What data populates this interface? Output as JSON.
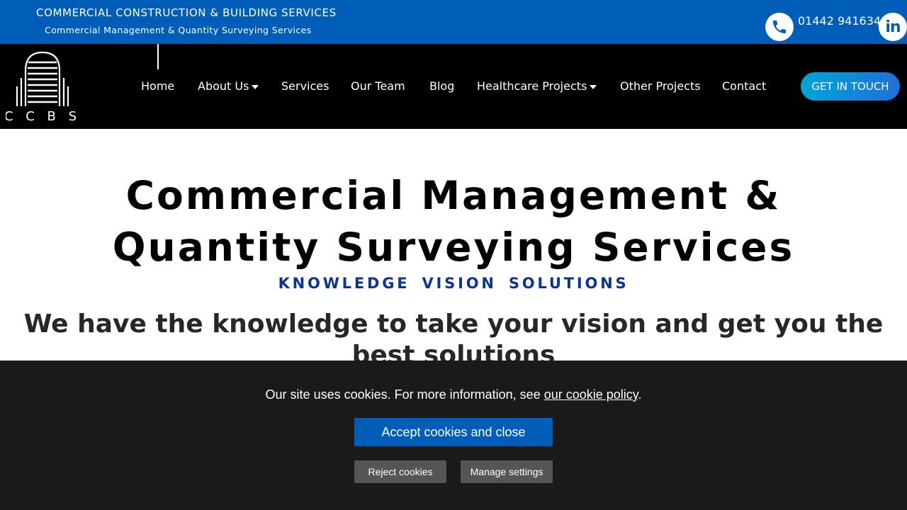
{
  "topbar": {
    "company": "COMMERCIAL CONSTRUCTION & BUILDING SERVICES",
    "tagline": "Commercial Management & Quantity Surveying Services",
    "phone": "01442 941634",
    "phone_icon": "phone-icon",
    "linkedin_icon": "linkedin-icon",
    "linkedin_text": "in"
  },
  "logo": {
    "text": "C C B S"
  },
  "nav": {
    "items": [
      {
        "label": "Home"
      },
      {
        "label": "About Us"
      },
      {
        "label": "Services"
      },
      {
        "label": "Our Team"
      },
      {
        "label": "Blog"
      },
      {
        "label": "Healthcare Projects"
      },
      {
        "label": "Other Projects"
      },
      {
        "label": "Contact"
      }
    ],
    "cta": "GET IN TOUCH"
  },
  "hero": {
    "title": "Commercial Management & Quantity Surveying Services",
    "subtitle": "KNOWLEDGE  VISION  SOLUTIONS",
    "statement": "We have the knowledge to take your vision and get you the best solutions"
  },
  "cookie": {
    "text_before": "Our site uses cookies. For more information, see ",
    "link": "our cookie policy",
    "text_after": ".",
    "accept": "Accept cookies and close",
    "reject": "Reject cookies",
    "manage": "Manage settings"
  },
  "colors": {
    "brand_blue": "#005eb8",
    "subtitle_blue": "#0b3590",
    "nav_bg": "#000000",
    "cookie_bg": "#1a1a1a"
  }
}
